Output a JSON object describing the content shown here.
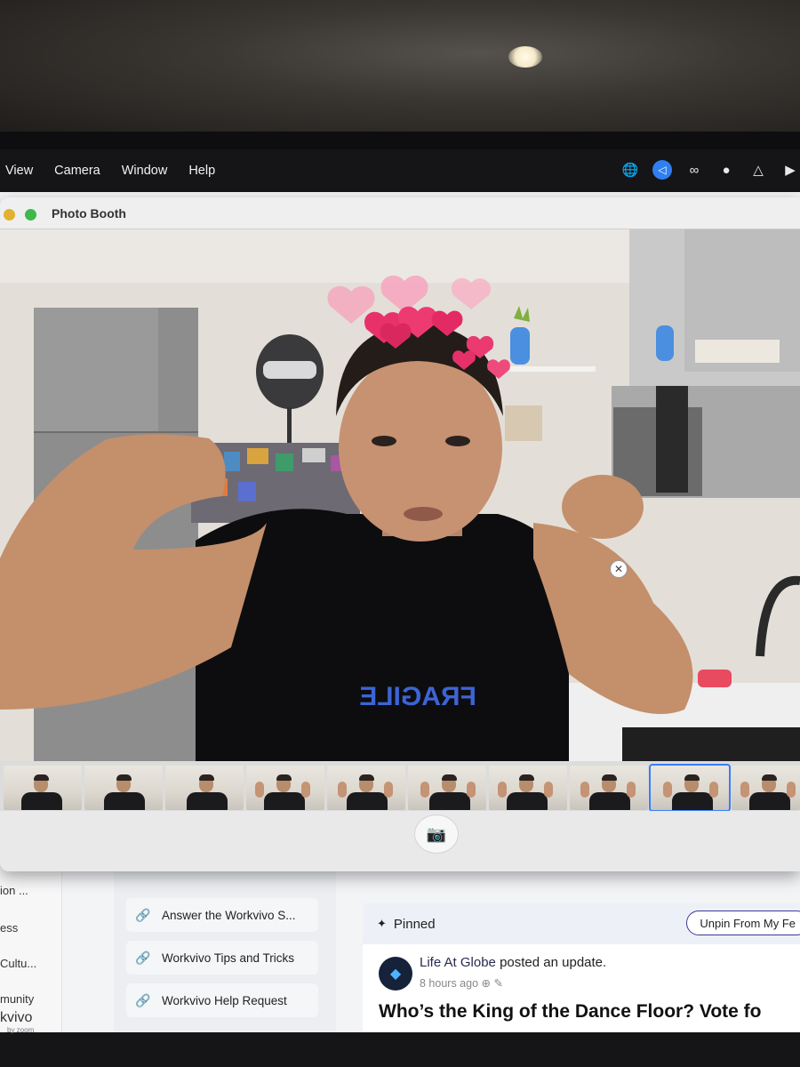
{
  "menubar": {
    "items": [
      "View",
      "Camera",
      "Window",
      "Help"
    ]
  },
  "status_icons": [
    "globe-icon",
    "send-icon",
    "creative-cloud-icon",
    "vpn-icon",
    "drive-icon",
    "play-icon"
  ],
  "window": {
    "title": "Photo Booth"
  },
  "photo": {
    "shirt_text": "FRAGILE",
    "effect": "hearts-crown"
  },
  "filmstrip": {
    "thumbnail_count": 10,
    "selected_index": 8,
    "delete_symbol": "✕"
  },
  "shutter": {
    "icon": "camera-icon"
  },
  "background_page": {
    "left_nav": [
      "ion ...",
      "ess",
      "Cultu...",
      "munity",
      "kvivo",
      "by zoom"
    ],
    "links": [
      "Answer the Workvivo S...",
      "Workvivo Tips and Tricks",
      "Workvivo Help Request"
    ],
    "pinned_label": "Pinned",
    "unpin_button": "Unpin From My Fe",
    "post_author": "Life At Globe",
    "post_action": "posted an update.",
    "post_time": "8 hours ago",
    "post_title": "Who’s the King of the Dance Floor? Vote fo"
  }
}
